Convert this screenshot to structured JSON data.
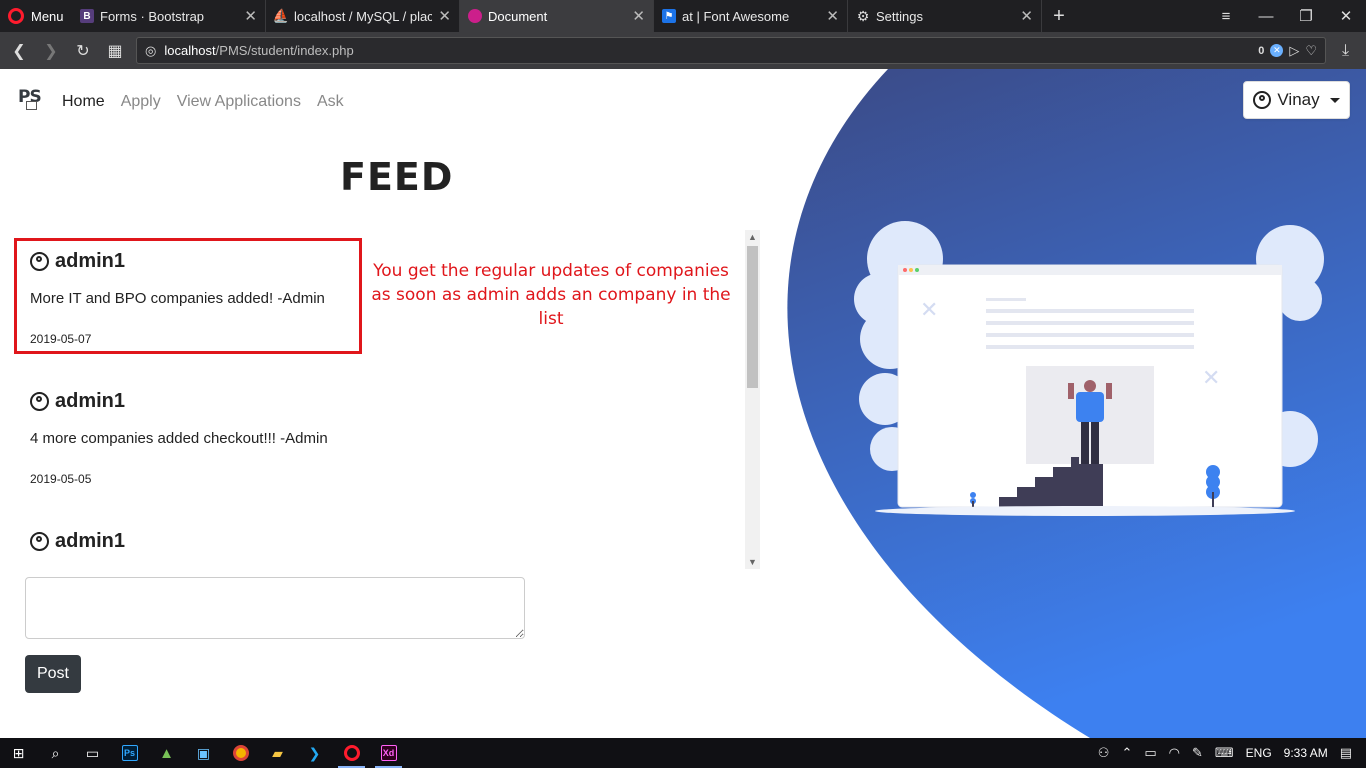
{
  "browser": {
    "menu_label": "Menu",
    "tabs": [
      {
        "title": "Forms · Bootstrap",
        "fav_color": "#563d7c",
        "fav_text": "B"
      },
      {
        "title": "localhost / MySQL / placem",
        "fav_color": "#f29111",
        "fav_text": "⚑"
      },
      {
        "title": "Document",
        "fav_color": "#cc1f8b",
        "fav_text": ""
      },
      {
        "title": "at | Font Awesome",
        "fav_color": "#1c73e8",
        "fav_text": "⚑"
      },
      {
        "title": "Settings",
        "fav_color": "#555",
        "fav_text": "⚙"
      }
    ],
    "url_host": "localhost",
    "url_path": "/PMS/student/index.php",
    "adblock_count": "0"
  },
  "nav": {
    "links": [
      "Home",
      "Apply",
      "View Applications",
      "Ask"
    ],
    "logo": "PS",
    "user_name": "Vinay"
  },
  "feed": {
    "title": "FEED",
    "posts": [
      {
        "author": "admin1",
        "body": "More IT and BPO companies added! -Admin",
        "date": "2019-05-07"
      },
      {
        "author": "admin1",
        "body": "4 more companies added checkout!!! -Admin",
        "date": "2019-05-05"
      },
      {
        "author": "admin1",
        "body": "",
        "date": ""
      }
    ]
  },
  "annotation": "You get the regular updates of companies as soon as admin adds an company in the list",
  "form": {
    "textarea_value": "",
    "post_label": "Post"
  },
  "colors": {
    "hero_top": "#3b4a86",
    "hero_bottom": "#3d7ef0",
    "highlight": "#e0161b"
  },
  "taskbar": {
    "lang": "ENG",
    "time": "9:33 AM"
  }
}
